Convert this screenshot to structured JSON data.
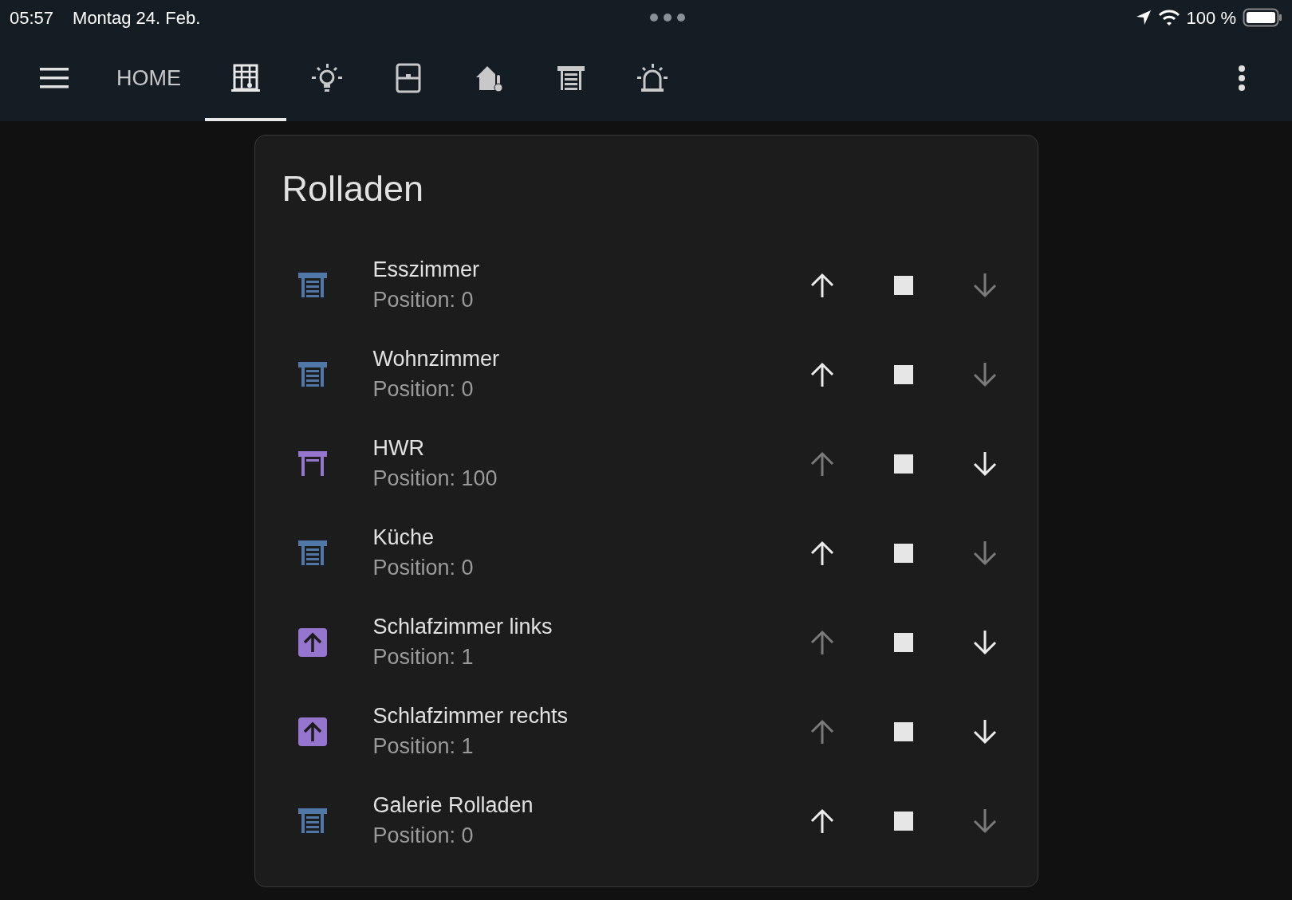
{
  "status_bar": {
    "time": "05:57",
    "date": "Montag 24. Feb.",
    "battery": "100 %"
  },
  "tabs": [
    {
      "kind": "text",
      "label": "HOME",
      "selected": false
    },
    {
      "kind": "window",
      "selected": true
    },
    {
      "kind": "bulb",
      "selected": false
    },
    {
      "kind": "door",
      "selected": false
    },
    {
      "kind": "home-thermo",
      "selected": false
    },
    {
      "kind": "shutter",
      "selected": false
    },
    {
      "kind": "siren",
      "selected": false
    }
  ],
  "card": {
    "title": "Rolladen",
    "rows": [
      {
        "name": "Esszimmer",
        "state": "Position: 0",
        "kind": "closed",
        "color": "#4f77a8",
        "up_disabled": false,
        "down_disabled": true
      },
      {
        "name": "Wohnzimmer",
        "state": "Position: 0",
        "kind": "closed",
        "color": "#4f77a8",
        "up_disabled": false,
        "down_disabled": true
      },
      {
        "name": "HWR",
        "state": "Position: 100",
        "kind": "open",
        "color": "#9575cd",
        "up_disabled": true,
        "down_disabled": false
      },
      {
        "name": "Küche",
        "state": "Position: 0",
        "kind": "closed",
        "color": "#4f77a8",
        "up_disabled": false,
        "down_disabled": true
      },
      {
        "name": "Schlafzimmer links",
        "state": "Position: 1",
        "kind": "opening",
        "color": "#9575cd",
        "up_disabled": true,
        "down_disabled": false
      },
      {
        "name": "Schlafzimmer rechts",
        "state": "Position: 1",
        "kind": "opening",
        "color": "#9575cd",
        "up_disabled": true,
        "down_disabled": false
      },
      {
        "name": "Galerie Rolladen",
        "state": "Position: 0",
        "kind": "closed",
        "color": "#4f77a8",
        "up_disabled": false,
        "down_disabled": true
      }
    ]
  }
}
